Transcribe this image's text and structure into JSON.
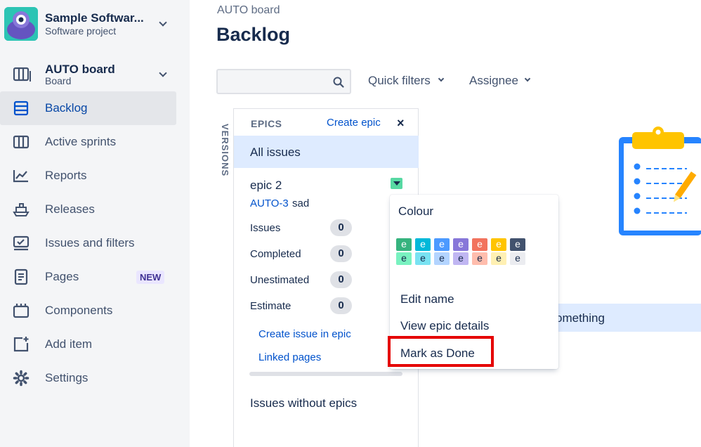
{
  "project": {
    "name": "Sample Softwar...",
    "type": "Software project"
  },
  "board": {
    "name": "AUTO board",
    "type": "Board"
  },
  "nav": [
    {
      "label": "Backlog",
      "icon": "backlog-icon",
      "active": true
    },
    {
      "label": "Active sprints",
      "icon": "active-sprints-icon"
    },
    {
      "label": "Reports",
      "icon": "reports-icon"
    },
    {
      "label": "Releases",
      "icon": "releases-icon"
    },
    {
      "label": "Issues and filters",
      "icon": "issues-filters-icon"
    },
    {
      "label": "Pages",
      "icon": "pages-icon",
      "badge": "NEW"
    },
    {
      "label": "Components",
      "icon": "components-icon"
    },
    {
      "label": "Add item",
      "icon": "add-item-icon"
    },
    {
      "label": "Settings",
      "icon": "settings-icon"
    }
  ],
  "header": {
    "breadcrumb": "AUTO board",
    "title": "Backlog",
    "search_placeholder": "",
    "filters": [
      "Quick filters",
      "Assignee"
    ]
  },
  "versions_tab": "VERSIONS",
  "epics": {
    "title": "EPICS",
    "create_label": "Create epic",
    "close_label": "×",
    "all_issues": "All issues",
    "epic": {
      "name": "epic 2",
      "key": "AUTO-3",
      "summary": "sad",
      "stats": [
        {
          "label": "Issues",
          "value": "0"
        },
        {
          "label": "Completed",
          "value": "0"
        },
        {
          "label": "Unestimated",
          "value": "0"
        },
        {
          "label": "Estimate",
          "value": "0"
        }
      ],
      "links": [
        "Create issue in epic",
        "Linked pages"
      ]
    },
    "without_epics": "Issues without epics"
  },
  "backlog_row_text": "omething",
  "menu": {
    "heading": "Colour",
    "swatch_letter": "e",
    "colors_dark": [
      "#36b37e",
      "#00b8d9",
      "#4c9aff",
      "#8777d9",
      "#f2735e",
      "#ffc400",
      "#42526e"
    ],
    "colors_light": [
      "#79f2c0",
      "#79e2f2",
      "#b3d4ff",
      "#c0b6f2",
      "#ffbdad",
      "#fff0b3",
      "#ebecf0"
    ],
    "items": [
      "Edit name",
      "View epic details",
      "Mark as Done"
    ]
  },
  "accent": "#0052cc",
  "highlight_color": "#e50000"
}
